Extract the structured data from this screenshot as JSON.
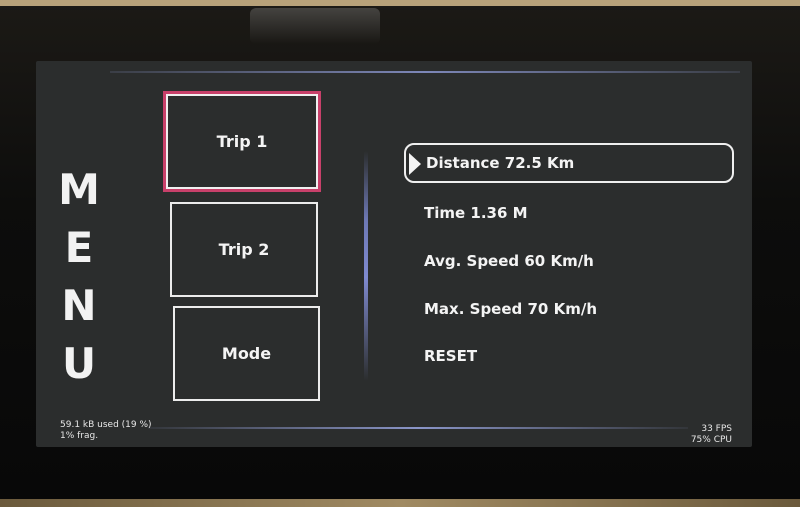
{
  "menu": {
    "title_letters": [
      "M",
      "E",
      "N",
      "U"
    ]
  },
  "trips": [
    {
      "label": "Trip 1",
      "selected": true
    },
    {
      "label": "Trip 2",
      "selected": false
    },
    {
      "label": "Mode",
      "selected": false
    }
  ],
  "info": {
    "distance": "Distance  72.5 Km",
    "time": "Time  1.36 M",
    "avg_speed": "Avg. Speed  60 Km/h",
    "max_speed": "Max. Speed  70 Km/h",
    "reset": "RESET"
  },
  "status": {
    "memory_used": "59.1 kB used (19 %)",
    "fragmentation": "1% frag.",
    "fps": "33 FPS",
    "cpu": "75% CPU"
  },
  "colors": {
    "screen_bg": "#2b2d2d",
    "selected_border": "#c8406a",
    "text": "#f4f4f4",
    "accent_line": "#7f8ad0"
  }
}
